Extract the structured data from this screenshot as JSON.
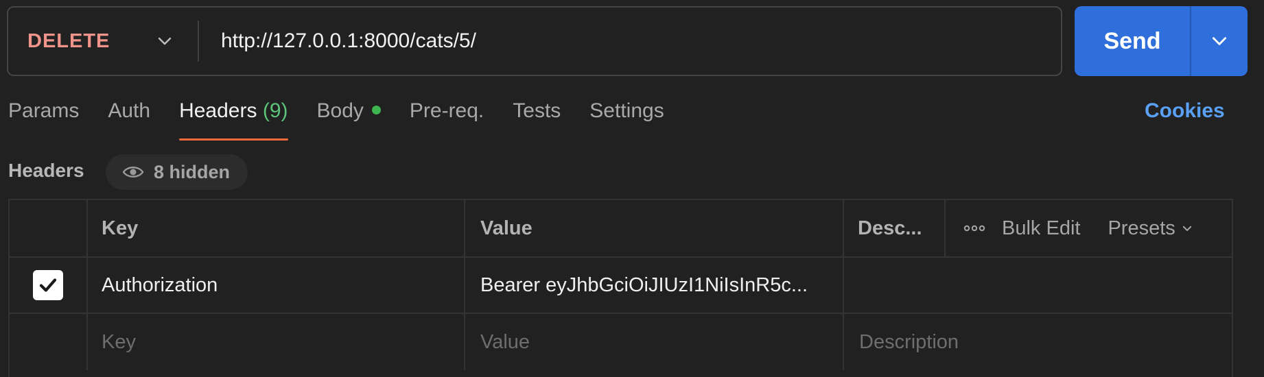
{
  "request": {
    "method": "DELETE",
    "url": "http://127.0.0.1:8000/cats/5/",
    "send_label": "Send"
  },
  "tabs": [
    {
      "label": "Params"
    },
    {
      "label": "Auth"
    },
    {
      "label": "Headers",
      "count": "(9)",
      "active": true
    },
    {
      "label": "Body",
      "has_dot": true
    },
    {
      "label": "Pre-req."
    },
    {
      "label": "Tests"
    },
    {
      "label": "Settings"
    }
  ],
  "cookies_label": "Cookies",
  "headers_section": {
    "title": "Headers",
    "hidden_label": "8 hidden"
  },
  "table": {
    "columns": {
      "key": "Key",
      "value": "Value",
      "description": "Desc..."
    },
    "tools": {
      "bulk_edit": "Bulk Edit",
      "presets": "Presets"
    },
    "rows": [
      {
        "checked": true,
        "key": "Authorization",
        "value": "Bearer eyJhbGciOiJIUzI1NiIsInR5c..."
      }
    ],
    "new_row_placeholders": {
      "key": "Key",
      "value": "Value",
      "description": "Description"
    }
  },
  "colors": {
    "method": "#f0938a",
    "send": "#2f6fdb",
    "active_tab_underline": "#ee6b3b",
    "count": "#5bc37a",
    "body_dot": "#3fb550",
    "link": "#5aa0f5"
  },
  "icons": [
    "chevron-down-icon",
    "eye-icon",
    "more-dots-icon",
    "checkmark-icon"
  ]
}
